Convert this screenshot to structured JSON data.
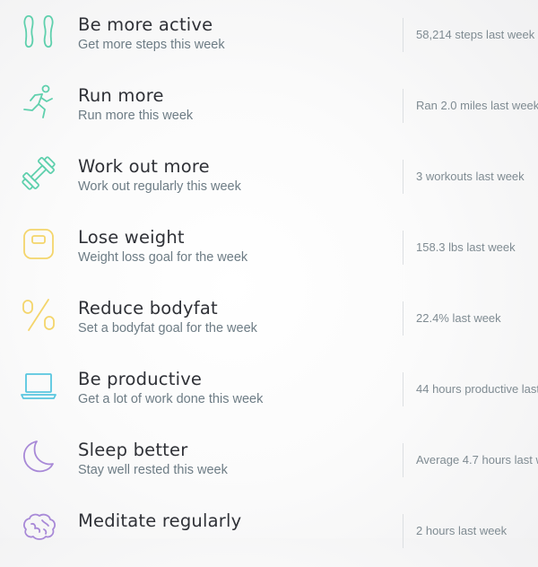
{
  "colors": {
    "teal": "#5fd0ad",
    "yellow": "#f4d56b",
    "blue": "#57c6df",
    "purple": "#a889d7"
  },
  "goals": [
    {
      "icon": "footprints-icon",
      "title": "Be more active",
      "subtitle": "Get more steps this week",
      "stat": "58,214 steps last week"
    },
    {
      "icon": "running-person-icon",
      "title": "Run more",
      "subtitle": "Run more this week",
      "stat": "Ran 2.0 miles last week"
    },
    {
      "icon": "dumbbell-icon",
      "title": "Work out more",
      "subtitle": "Work out regularly this week",
      "stat": "3 workouts last week"
    },
    {
      "icon": "scale-icon",
      "title": "Lose weight",
      "subtitle": "Weight loss goal for the week",
      "stat": "158.3 lbs last week"
    },
    {
      "icon": "percent-icon",
      "title": "Reduce bodyfat",
      "subtitle": "Set a bodyfat goal for the week",
      "stat": "22.4% last week"
    },
    {
      "icon": "laptop-icon",
      "title": "Be productive",
      "subtitle": "Get a lot of work done this week",
      "stat": "44 hours productive last"
    },
    {
      "icon": "crescent-moon-icon",
      "title": "Sleep better",
      "subtitle": "Stay well rested this week",
      "stat": "Average 4.7 hours last w"
    },
    {
      "icon": "brain-icon",
      "title": "Meditate regularly",
      "subtitle": "",
      "stat": "2 hours last week"
    }
  ]
}
